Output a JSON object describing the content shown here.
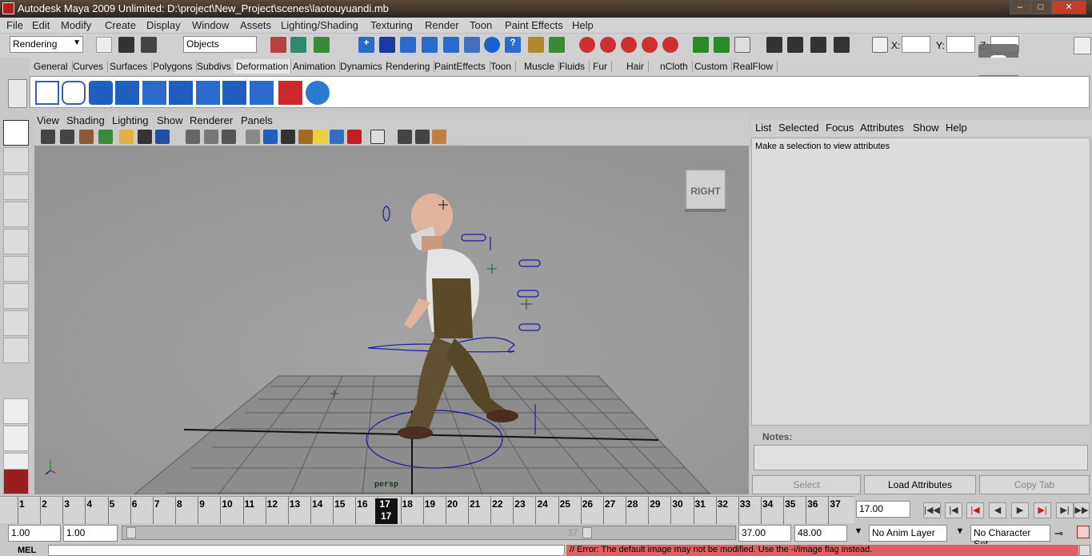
{
  "title": "Autodesk Maya 2009 Unlimited: D:\\project\\New_Project\\scenes\\laotouyuandi.mb",
  "window_buttons": {
    "min": "–",
    "max": "□",
    "close": "✕"
  },
  "menus": [
    "File",
    "Edit",
    "Modify",
    "Create",
    "Display",
    "Window",
    "Assets",
    "Lighting/Shading",
    "Texturing",
    "Render",
    "Toon",
    "Paint Effects",
    "Help"
  ],
  "status": {
    "menuset": "Rendering",
    "selection_field": "Objects",
    "x_label": "X:",
    "y_label": "Y:",
    "z_label": "Z:"
  },
  "shelf_tabs": [
    "General",
    "Curves",
    "Surfaces",
    "Polygons",
    "Subdivs",
    "Deformation",
    "Animation",
    "Dynamics",
    "Rendering",
    "PaintEffects",
    "Toon",
    "Muscle",
    "Fluids",
    "Fur",
    "Hair",
    "nCloth",
    "Custom",
    "RealFlow"
  ],
  "active_shelf": "Deformation",
  "panel_menus": [
    "View",
    "Shading",
    "Lighting",
    "Show",
    "Renderer",
    "Panels"
  ],
  "viewcube_label": "RIGHT",
  "camera_label": "persp",
  "attr_menus": [
    "List",
    "Selected",
    "Focus",
    "Attributes",
    "Show",
    "Help"
  ],
  "attr_message": "Make a selection to view attributes",
  "notes_label": "Notes:",
  "attr_buttons": {
    "select": "Select",
    "load": "Load Attributes",
    "copy": "Copy Tab"
  },
  "timeline": {
    "ticks": [
      "1",
      "2",
      "3",
      "4",
      "5",
      "6",
      "7",
      "8",
      "9",
      "10",
      "11",
      "12",
      "13",
      "14",
      "15",
      "16",
      "17",
      "18",
      "19",
      "20",
      "21",
      "22",
      "23",
      "24",
      "25",
      "26",
      "27",
      "28",
      "29",
      "30",
      "31",
      "32",
      "33",
      "34",
      "35",
      "36",
      "37"
    ],
    "current": "17",
    "current_field": "17.00"
  },
  "range": {
    "start": "1.00",
    "playback_start": "1.00",
    "slider_label": "37",
    "playback_end": "37.00",
    "end": "48.00",
    "anim_layer": "No Anim Layer",
    "char_set": "No Character Set"
  },
  "command": {
    "label": "MEL",
    "error": "// Error: The default image may not be modified. Use the -i/image flag instead."
  },
  "colors": {
    "titlebar": "#3a2e26",
    "viewport": "#9a9a9a",
    "error": "#e06060"
  }
}
